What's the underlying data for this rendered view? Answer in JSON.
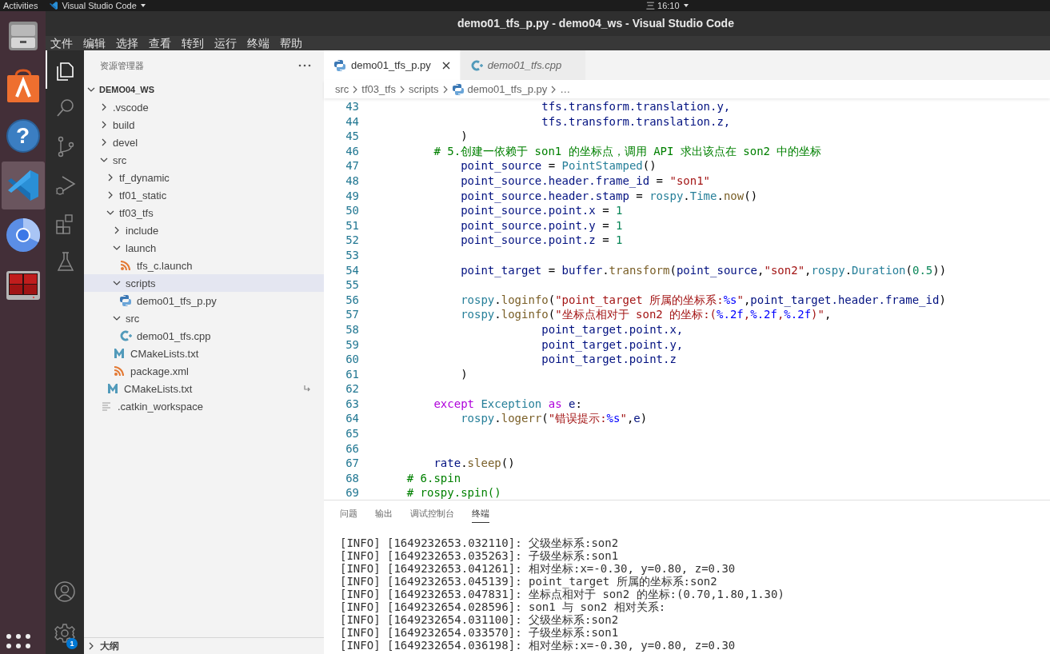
{
  "top_bar": {
    "activities": "Activities",
    "app_menu": "Visual Studio Code",
    "clock": "三 16:10"
  },
  "dock": {
    "items": [
      {
        "kind": "files",
        "selected": false
      },
      {
        "kind": "software",
        "selected": false
      },
      {
        "kind": "help",
        "selected": false,
        "glyph": "?"
      },
      {
        "kind": "vscode",
        "selected": true
      },
      {
        "kind": "browser",
        "selected": false
      },
      {
        "kind": "terminal",
        "selected": false
      }
    ]
  },
  "window": {
    "title": "demo01_tfs_p.py - demo04_ws - Visual Studio Code"
  },
  "menu": [
    "文件",
    "编辑",
    "选择",
    "查看",
    "转到",
    "运行",
    "终端",
    "帮助"
  ],
  "activity_bar": {
    "items": [
      {
        "kind": "explorer",
        "selected": true
      },
      {
        "kind": "search",
        "selected": false
      },
      {
        "kind": "source-control",
        "selected": false
      },
      {
        "kind": "debug",
        "selected": false
      },
      {
        "kind": "extensions",
        "selected": false
      },
      {
        "kind": "testing",
        "selected": false
      }
    ],
    "bottom": [
      {
        "kind": "account"
      },
      {
        "kind": "settings",
        "badge": "1"
      }
    ]
  },
  "sidebar": {
    "title": "资源管理器",
    "root": {
      "label": "DEMO04_WS",
      "expanded": true
    },
    "tree": [
      {
        "label": ".vscode",
        "kind": "folder",
        "expanded": false,
        "selected": false,
        "symlink": false
      },
      {
        "label": "build",
        "kind": "folder",
        "expanded": false,
        "selected": false,
        "symlink": false
      },
      {
        "label": "devel",
        "kind": "folder",
        "expanded": false,
        "selected": false,
        "symlink": false
      },
      {
        "label": "src",
        "kind": "folder",
        "expanded": true,
        "selected": false,
        "symlink": false,
        "children": [
          {
            "label": "tf_dynamic",
            "kind": "folder",
            "expanded": false,
            "selected": false,
            "symlink": false
          },
          {
            "label": "tf01_static",
            "kind": "folder",
            "expanded": false,
            "selected": false,
            "symlink": false
          },
          {
            "label": "tf03_tfs",
            "kind": "folder",
            "expanded": true,
            "selected": false,
            "symlink": false,
            "children": [
              {
                "label": "include",
                "kind": "folder",
                "expanded": false,
                "selected": false,
                "symlink": false
              },
              {
                "label": "launch",
                "kind": "folder",
                "expanded": true,
                "selected": false,
                "symlink": false,
                "children": [
                  {
                    "label": "tfs_c.launch",
                    "kind": "xml",
                    "selected": false,
                    "symlink": false
                  }
                ]
              },
              {
                "label": "scripts",
                "kind": "folder",
                "expanded": true,
                "selected": true,
                "symlink": false,
                "children": [
                  {
                    "label": "demo01_tfs_p.py",
                    "kind": "python",
                    "selected": false,
                    "symlink": false
                  }
                ]
              },
              {
                "label": "src",
                "kind": "folder",
                "expanded": true,
                "selected": false,
                "symlink": false,
                "children": [
                  {
                    "label": "demo01_tfs.cpp",
                    "kind": "cpp",
                    "selected": false,
                    "symlink": false
                  }
                ]
              },
              {
                "label": "CMakeLists.txt",
                "kind": "cmake",
                "selected": false,
                "symlink": false
              },
              {
                "label": "package.xml",
                "kind": "xml",
                "selected": false,
                "symlink": false
              }
            ]
          },
          {
            "label": "CMakeLists.txt",
            "kind": "cmake",
            "selected": false,
            "symlink": true
          }
        ]
      },
      {
        "label": ".catkin_workspace",
        "kind": "text",
        "selected": false,
        "symlink": false
      }
    ],
    "outline": {
      "label": "大纲",
      "expanded": false
    }
  },
  "tabs": [
    {
      "label": "demo01_tfs_p.py",
      "kind": "python",
      "selected": true,
      "preview": false
    },
    {
      "label": "demo01_tfs.cpp",
      "kind": "cpp",
      "selected": false,
      "preview": true
    }
  ],
  "breadcrumbs": [
    {
      "label": "src",
      "kind": "folder"
    },
    {
      "label": "tf03_tfs",
      "kind": "folder"
    },
    {
      "label": "scripts",
      "kind": "folder"
    },
    {
      "label": "demo01_tfs_p.py",
      "kind": "python"
    },
    {
      "label": "…",
      "kind": "more"
    }
  ],
  "editor": {
    "lines": [
      {
        "number": "43",
        "tokens": [
          {
            "text": "                        tfs.transform.translation.y,",
            "kind": "var"
          }
        ]
      },
      {
        "number": "44",
        "tokens": [
          {
            "text": "                        tfs.transform.translation.z,",
            "kind": "var"
          }
        ]
      },
      {
        "number": "45",
        "tokens": [
          {
            "text": "            )",
            "kind": "op"
          }
        ]
      },
      {
        "number": "46",
        "tokens": [
          {
            "text": "        # 5.创建一依赖于 son1 的坐标点，调用 API 求出该点在 son2 中的坐标",
            "kind": "comment"
          }
        ]
      },
      {
        "number": "47",
        "tokens": [
          {
            "text": "            point_source",
            "kind": "var"
          },
          {
            "text": " = ",
            "kind": "op"
          },
          {
            "text": "PointStamped",
            "kind": "class"
          },
          {
            "text": "()",
            "kind": "op"
          }
        ]
      },
      {
        "number": "48",
        "tokens": [
          {
            "text": "            point_source.header.frame_id",
            "kind": "var"
          },
          {
            "text": " = ",
            "kind": "op"
          },
          {
            "text": "\"son1\"",
            "kind": "string"
          }
        ]
      },
      {
        "number": "49",
        "tokens": [
          {
            "text": "            point_source.header.stamp",
            "kind": "var"
          },
          {
            "text": " = ",
            "kind": "op"
          },
          {
            "text": "rospy",
            "kind": "class"
          },
          {
            "text": ".",
            "kind": "op"
          },
          {
            "text": "Time",
            "kind": "class"
          },
          {
            "text": ".",
            "kind": "op"
          },
          {
            "text": "now",
            "kind": "function"
          },
          {
            "text": "()",
            "kind": "op"
          }
        ]
      },
      {
        "number": "50",
        "tokens": [
          {
            "text": "            point_source.point.x",
            "kind": "var"
          },
          {
            "text": " = ",
            "kind": "op"
          },
          {
            "text": "1",
            "kind": "number"
          }
        ]
      },
      {
        "number": "51",
        "tokens": [
          {
            "text": "            point_source.point.y",
            "kind": "var"
          },
          {
            "text": " = ",
            "kind": "op"
          },
          {
            "text": "1",
            "kind": "number"
          }
        ]
      },
      {
        "number": "52",
        "tokens": [
          {
            "text": "            point_source.point.z",
            "kind": "var"
          },
          {
            "text": " = ",
            "kind": "op"
          },
          {
            "text": "1",
            "kind": "number"
          }
        ]
      },
      {
        "number": "53"
      },
      {
        "number": "54",
        "tokens": [
          {
            "text": "            point_target",
            "kind": "var"
          },
          {
            "text": " = ",
            "kind": "op"
          },
          {
            "text": "buffer",
            "kind": "var"
          },
          {
            "text": ".",
            "kind": "op"
          },
          {
            "text": "transform",
            "kind": "function"
          },
          {
            "text": "(",
            "kind": "op"
          },
          {
            "text": "point_source",
            "kind": "var"
          },
          {
            "text": ",",
            "kind": "op"
          },
          {
            "text": "\"son2\"",
            "kind": "string"
          },
          {
            "text": ",",
            "kind": "op"
          },
          {
            "text": "rospy",
            "kind": "class"
          },
          {
            "text": ".",
            "kind": "op"
          },
          {
            "text": "Duration",
            "kind": "class"
          },
          {
            "text": "(",
            "kind": "op"
          },
          {
            "text": "0.5",
            "kind": "number"
          },
          {
            "text": "))",
            "kind": "op"
          }
        ]
      },
      {
        "number": "55"
      },
      {
        "number": "56",
        "tokens": [
          {
            "text": "            rospy",
            "kind": "class"
          },
          {
            "text": ".",
            "kind": "op"
          },
          {
            "text": "loginfo",
            "kind": "function"
          },
          {
            "text": "(",
            "kind": "op"
          },
          {
            "text": "\"point_target 所属的坐标系:",
            "kind": "string"
          },
          {
            "text": "%s",
            "kind": "format"
          },
          {
            "text": "\"",
            "kind": "string"
          },
          {
            "text": ",",
            "kind": "op"
          },
          {
            "text": "point_target.header.frame_id",
            "kind": "var"
          },
          {
            "text": ")",
            "kind": "op"
          }
        ]
      },
      {
        "number": "57",
        "tokens": [
          {
            "text": "            rospy",
            "kind": "class"
          },
          {
            "text": ".",
            "kind": "op"
          },
          {
            "text": "loginfo",
            "kind": "function"
          },
          {
            "text": "(",
            "kind": "op"
          },
          {
            "text": "\"坐标点相对于 son2 的坐标:(",
            "kind": "string"
          },
          {
            "text": "%.2f",
            "kind": "format"
          },
          {
            "text": ",",
            "kind": "string"
          },
          {
            "text": "%.2f",
            "kind": "format"
          },
          {
            "text": ",",
            "kind": "string"
          },
          {
            "text": "%.2f",
            "kind": "format"
          },
          {
            "text": ")\"",
            "kind": "string"
          },
          {
            "text": ",",
            "kind": "op"
          }
        ]
      },
      {
        "number": "58",
        "tokens": [
          {
            "text": "                        point_target.point.x,",
            "kind": "var"
          }
        ]
      },
      {
        "number": "59",
        "tokens": [
          {
            "text": "                        point_target.point.y,",
            "kind": "var"
          }
        ]
      },
      {
        "number": "60",
        "tokens": [
          {
            "text": "                        point_target.point.z",
            "kind": "var"
          }
        ]
      },
      {
        "number": "61",
        "tokens": [
          {
            "text": "            )",
            "kind": "op"
          }
        ]
      },
      {
        "number": "62"
      },
      {
        "number": "63",
        "tokens": [
          {
            "text": "        except",
            "kind": "keyword"
          },
          {
            "text": " Exception",
            "kind": "class"
          },
          {
            "text": " as",
            "kind": "keyword"
          },
          {
            "text": " e",
            "kind": "var"
          },
          {
            "text": ":",
            "kind": "op"
          }
        ]
      },
      {
        "number": "64",
        "tokens": [
          {
            "text": "            rospy",
            "kind": "class"
          },
          {
            "text": ".",
            "kind": "op"
          },
          {
            "text": "logerr",
            "kind": "function"
          },
          {
            "text": "(",
            "kind": "op"
          },
          {
            "text": "\"错误提示:",
            "kind": "string"
          },
          {
            "text": "%s",
            "kind": "format"
          },
          {
            "text": "\"",
            "kind": "string"
          },
          {
            "text": ",",
            "kind": "op"
          },
          {
            "text": "e",
            "kind": "var"
          },
          {
            "text": ")",
            "kind": "op"
          }
        ]
      },
      {
        "number": "65"
      },
      {
        "number": "66"
      },
      {
        "number": "67",
        "tokens": [
          {
            "text": "        rate",
            "kind": "var"
          },
          {
            "text": ".",
            "kind": "op"
          },
          {
            "text": "sleep",
            "kind": "function"
          },
          {
            "text": "()",
            "kind": "op"
          }
        ]
      },
      {
        "number": "68",
        "tokens": [
          {
            "text": "    # 6.spin",
            "kind": "comment"
          }
        ]
      },
      {
        "number": "69",
        "tokens": [
          {
            "text": "    # rospy.spin()",
            "kind": "comment"
          }
        ]
      }
    ]
  },
  "panel": {
    "tabs": [
      {
        "label": "问题",
        "selected": false
      },
      {
        "label": "输出",
        "selected": false
      },
      {
        "label": "调试控制台",
        "selected": false
      },
      {
        "label": "终端",
        "selected": true
      }
    ],
    "terminal": [
      "[INFO] [1649232653.032110]: 父级坐标系:son2",
      "[INFO] [1649232653.035263]: 子级坐标系:son1",
      "[INFO] [1649232653.041261]: 相对坐标:x=-0.30, y=0.80, z=0.30",
      "[INFO] [1649232653.045139]: point_target 所属的坐标系:son2",
      "[INFO] [1649232653.047831]: 坐标点相对于 son2 的坐标:(0.70,1.80,1.30)",
      "[INFO] [1649232654.028596]: son1 与 son2 相对关系:",
      "[INFO] [1649232654.031100]: 父级坐标系:son2",
      "[INFO] [1649232654.033570]: 子级坐标系:son1",
      "[INFO] [1649232654.036198]: 相对坐标:x=-0.30, y=0.80, z=0.30"
    ]
  }
}
